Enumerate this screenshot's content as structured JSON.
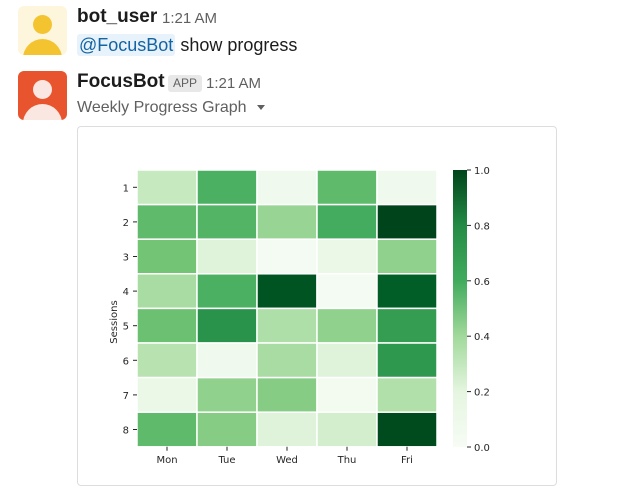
{
  "messages": [
    {
      "user": "bot_user",
      "time": "1:21 AM",
      "mention": "@FocusBot",
      "text": "show progress"
    },
    {
      "user": "FocusBot",
      "badge": "APP",
      "time": "1:21 AM",
      "attachment_title": "Weekly Progress Graph"
    }
  ],
  "colors": {
    "mention_bg": "#e8f2fb",
    "mention_fg": "#1264a3",
    "cmap_low": "#f7fcf5",
    "cmap_high": "#00441b"
  },
  "chart_data": {
    "type": "heatmap",
    "title": "",
    "xlabel": "",
    "ylabel": "Sessions",
    "x_categories": [
      "Mon",
      "Tue",
      "Wed",
      "Thu",
      "Fri"
    ],
    "y_categories": [
      "1",
      "2",
      "3",
      "4",
      "5",
      "6",
      "7",
      "8"
    ],
    "values": [
      [
        0.25,
        0.6,
        0.05,
        0.55,
        0.05
      ],
      [
        0.55,
        0.58,
        0.4,
        0.62,
        1.0
      ],
      [
        0.5,
        0.15,
        0.02,
        0.08,
        0.42
      ],
      [
        0.35,
        0.6,
        0.95,
        0.02,
        0.92
      ],
      [
        0.52,
        0.72,
        0.33,
        0.42,
        0.68
      ],
      [
        0.3,
        0.05,
        0.35,
        0.15,
        0.7
      ],
      [
        0.08,
        0.42,
        0.45,
        0.03,
        0.32
      ],
      [
        0.55,
        0.45,
        0.15,
        0.2,
        0.98
      ]
    ],
    "colorbar": {
      "min": 0.0,
      "max": 1.0,
      "ticks": [
        "0.0",
        "0.2",
        "0.4",
        "0.6",
        "0.8",
        "1.0"
      ]
    },
    "grid": true
  }
}
